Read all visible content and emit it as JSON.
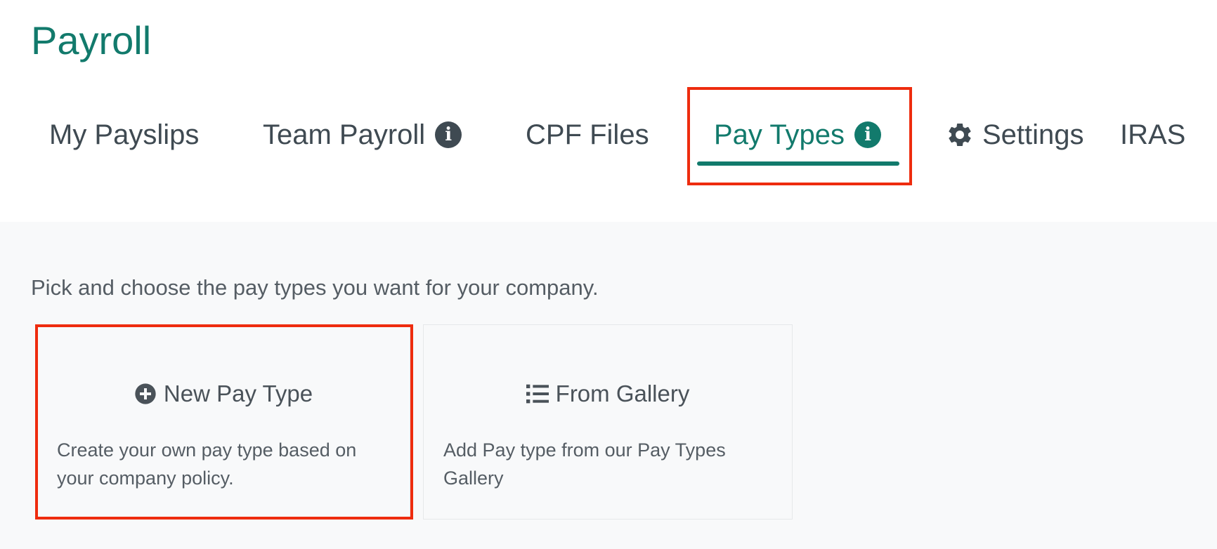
{
  "page": {
    "title": "Payroll"
  },
  "tabs": [
    {
      "label": "My Payslips",
      "has_info": false
    },
    {
      "label": "Team Payroll",
      "has_info": true
    },
    {
      "label": "CPF Files",
      "has_info": false
    },
    {
      "label": "Pay Types",
      "has_info": true,
      "active": true
    },
    {
      "label": "Settings",
      "icon": "gear-icon"
    },
    {
      "label": "IRAS"
    }
  ],
  "info_glyph": "i",
  "content": {
    "intro": "Pick and choose the pay types you want for your company.",
    "cards": [
      {
        "title": "New Pay Type",
        "icon": "plus-circle-icon",
        "description": "Create your own pay type based on your company policy."
      },
      {
        "title": "From Gallery",
        "icon": "list-icon",
        "description": "Add Pay type from our Pay Types Gallery"
      }
    ]
  },
  "colors": {
    "accent": "#127a6c",
    "text": "#3f4a52",
    "highlight": "#ee2c0e",
    "content_bg": "#f8f9fa"
  }
}
